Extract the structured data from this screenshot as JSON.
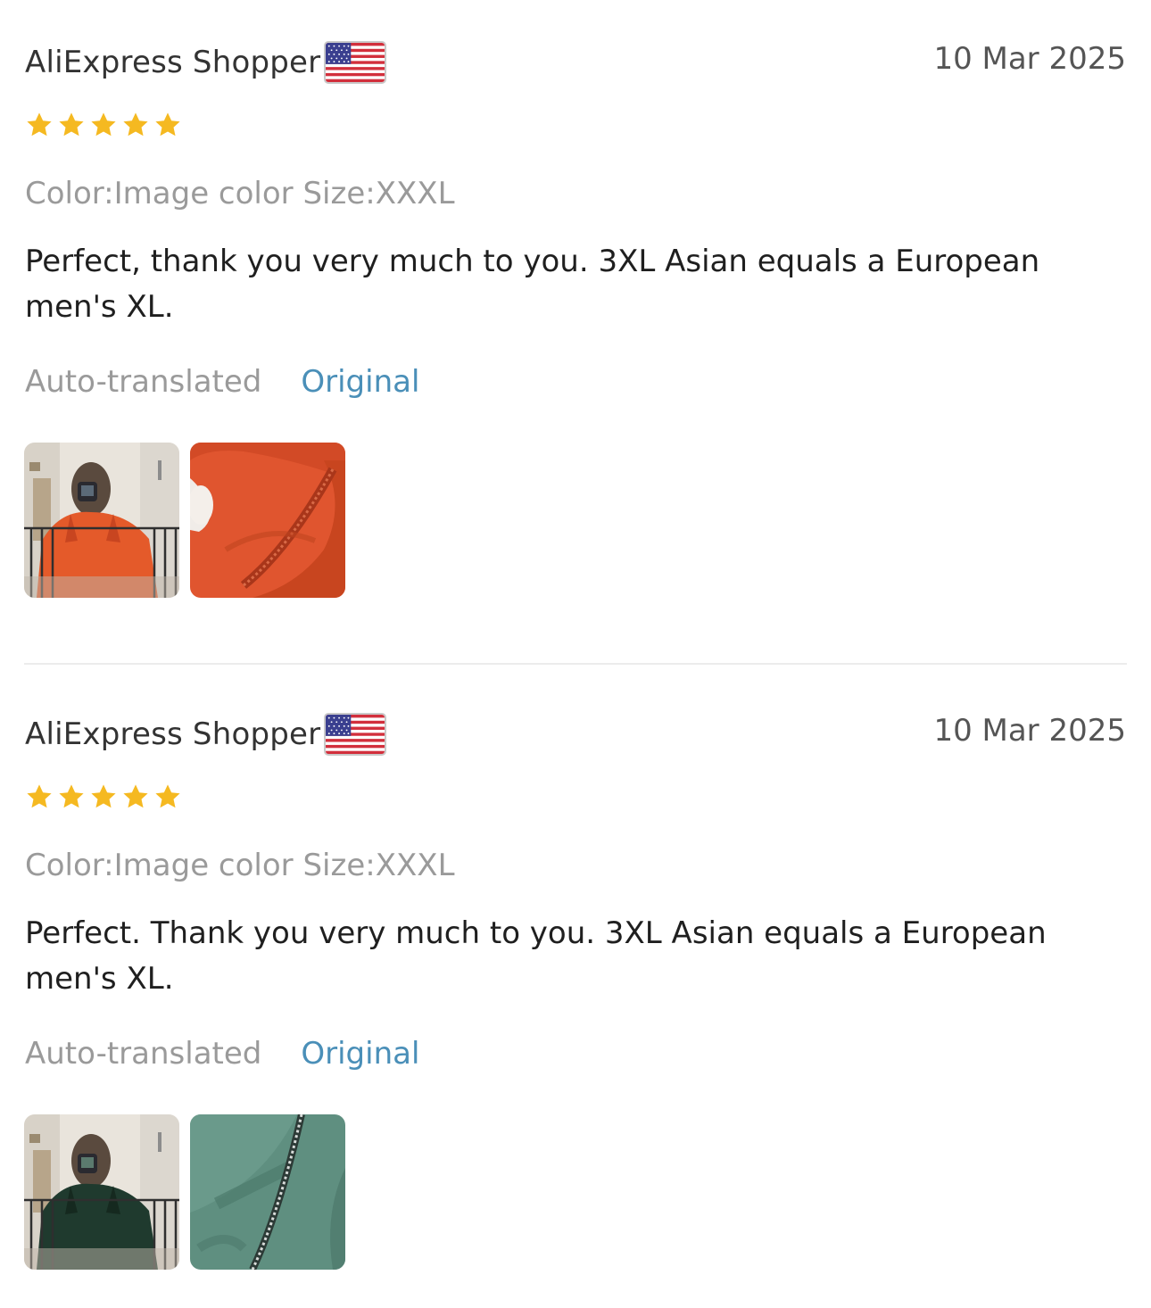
{
  "reviews": [
    {
      "author": "AliExpress Shopper",
      "country_flag_icon": "us-flag-icon",
      "date": "10 Mar 2025",
      "rating": 5,
      "rating_max": 5,
      "sku": "Color:Image color Size:XXXL",
      "text": "Perfect, thank you very much to you. 3XL Asian equals a European men's XL.",
      "translation_label": "Auto-translated",
      "original_link": "Original",
      "photos": [
        {
          "subject": "mirror-selfie-orange-hoodie"
        },
        {
          "subject": "orange-fabric-zipper-closeup"
        }
      ]
    },
    {
      "author": "AliExpress Shopper",
      "country_flag_icon": "us-flag-icon",
      "date": "10 Mar 2025",
      "rating": 5,
      "rating_max": 5,
      "sku": "Color:Image color Size:XXXL",
      "text": "Perfect. Thank you very much to you. 3XL Asian equals a European men's XL.",
      "translation_label": "Auto-translated",
      "original_link": "Original",
      "photos": [
        {
          "subject": "mirror-selfie-green-hoodie"
        },
        {
          "subject": "green-fabric-zipper-closeup"
        }
      ]
    }
  ],
  "colors": {
    "star": "#f5b921",
    "link": "#4a8fb8",
    "muted": "#9a9a9a",
    "orange_fabric": "#e0552f",
    "green_fabric": "#5f8f80"
  }
}
